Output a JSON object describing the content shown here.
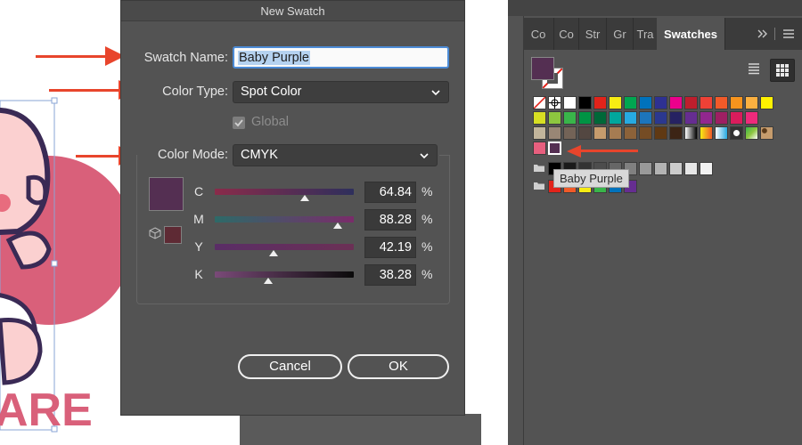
{
  "dialog": {
    "title": "New Swatch",
    "swatch_name_label": "Swatch Name:",
    "swatch_name_value": "Baby Purple",
    "color_type_label": "Color Type:",
    "color_type_value": "Spot Color",
    "global_label": "Global",
    "global_checked": true,
    "color_mode_label": "Color Mode:",
    "color_mode_value": "CMYK",
    "preview_color": "#542f52",
    "gamut_color": "#5e2a34",
    "channels": [
      {
        "name": "C",
        "value": "64.84",
        "unit": "%",
        "fraction": 0.6484
      },
      {
        "name": "M",
        "value": "88.28",
        "unit": "%",
        "fraction": 0.8828
      },
      {
        "name": "Y",
        "value": "42.19",
        "unit": "%",
        "fraction": 0.4219
      },
      {
        "name": "K",
        "value": "38.28",
        "unit": "%",
        "fraction": 0.3828
      }
    ],
    "cancel_label": "Cancel",
    "ok_label": "OK"
  },
  "artwork": {
    "visible_text": "ARE",
    "accent_color": "#d9607a"
  },
  "panel": {
    "tabs": [
      "Co",
      "Co",
      "Str",
      "Gr",
      "Tra",
      "Swatches"
    ],
    "active_tab": "Swatches",
    "overflow_icon": "double-chevron-right-icon",
    "menu_icon": "hamburger-menu-icon",
    "view_list_icon": "list-view-icon",
    "view_grid_icon": "grid-view-icon",
    "fill_color": "#542f52",
    "tooltip": "Baby Purple",
    "swatch_rows": [
      [
        "none",
        "registration",
        "#ffffff",
        "#000000",
        "#e2231a",
        "#f7ec13",
        "#00a651",
        "#0072bc",
        "#2e3192",
        "#ec008c",
        "#be1e2d",
        "#ef4136",
        "#f15a29",
        "#f7941d",
        "#fbb040",
        "#fff200"
      ],
      [
        "#d7df23",
        "#8dc63f",
        "#39b54a",
        "#009444",
        "#006838",
        "#00a79d",
        "#27aae1",
        "#1c75bc",
        "#2b388f",
        "#262262",
        "#662d91",
        "#92278f",
        "#9e1f63",
        "#da1c5c",
        "#ee2a7b"
      ],
      [
        "#c2b59b",
        "#998675",
        "#736357",
        "#534741",
        "#c69c6d",
        "#a67c52",
        "#8c6239",
        "#754c24",
        "#603913",
        "#3c2415",
        "gradient-bw",
        "gradient-orange",
        "gradient-blue",
        "pattern-dots",
        "pattern-green",
        "pattern-leopard"
      ],
      [
        "#e75f7e",
        "#542f52"
      ]
    ],
    "gray_group": [
      "#000000",
      "#1a1a1a",
      "#333333",
      "#4d4d4d",
      "#666666",
      "#808080",
      "#999999",
      "#b3b3b3",
      "#cccccc",
      "#e6e6e6",
      "#f2f2f2"
    ],
    "color_group": [
      "#e2231a",
      "#f15a29",
      "#f7ec13",
      "#39b54a",
      "#0072bc",
      "#662d91"
    ]
  },
  "colors": {
    "annotation_arrow": "#e8452c",
    "dialog_bg": "#535353",
    "focus_ring": "#4c8bd6"
  }
}
